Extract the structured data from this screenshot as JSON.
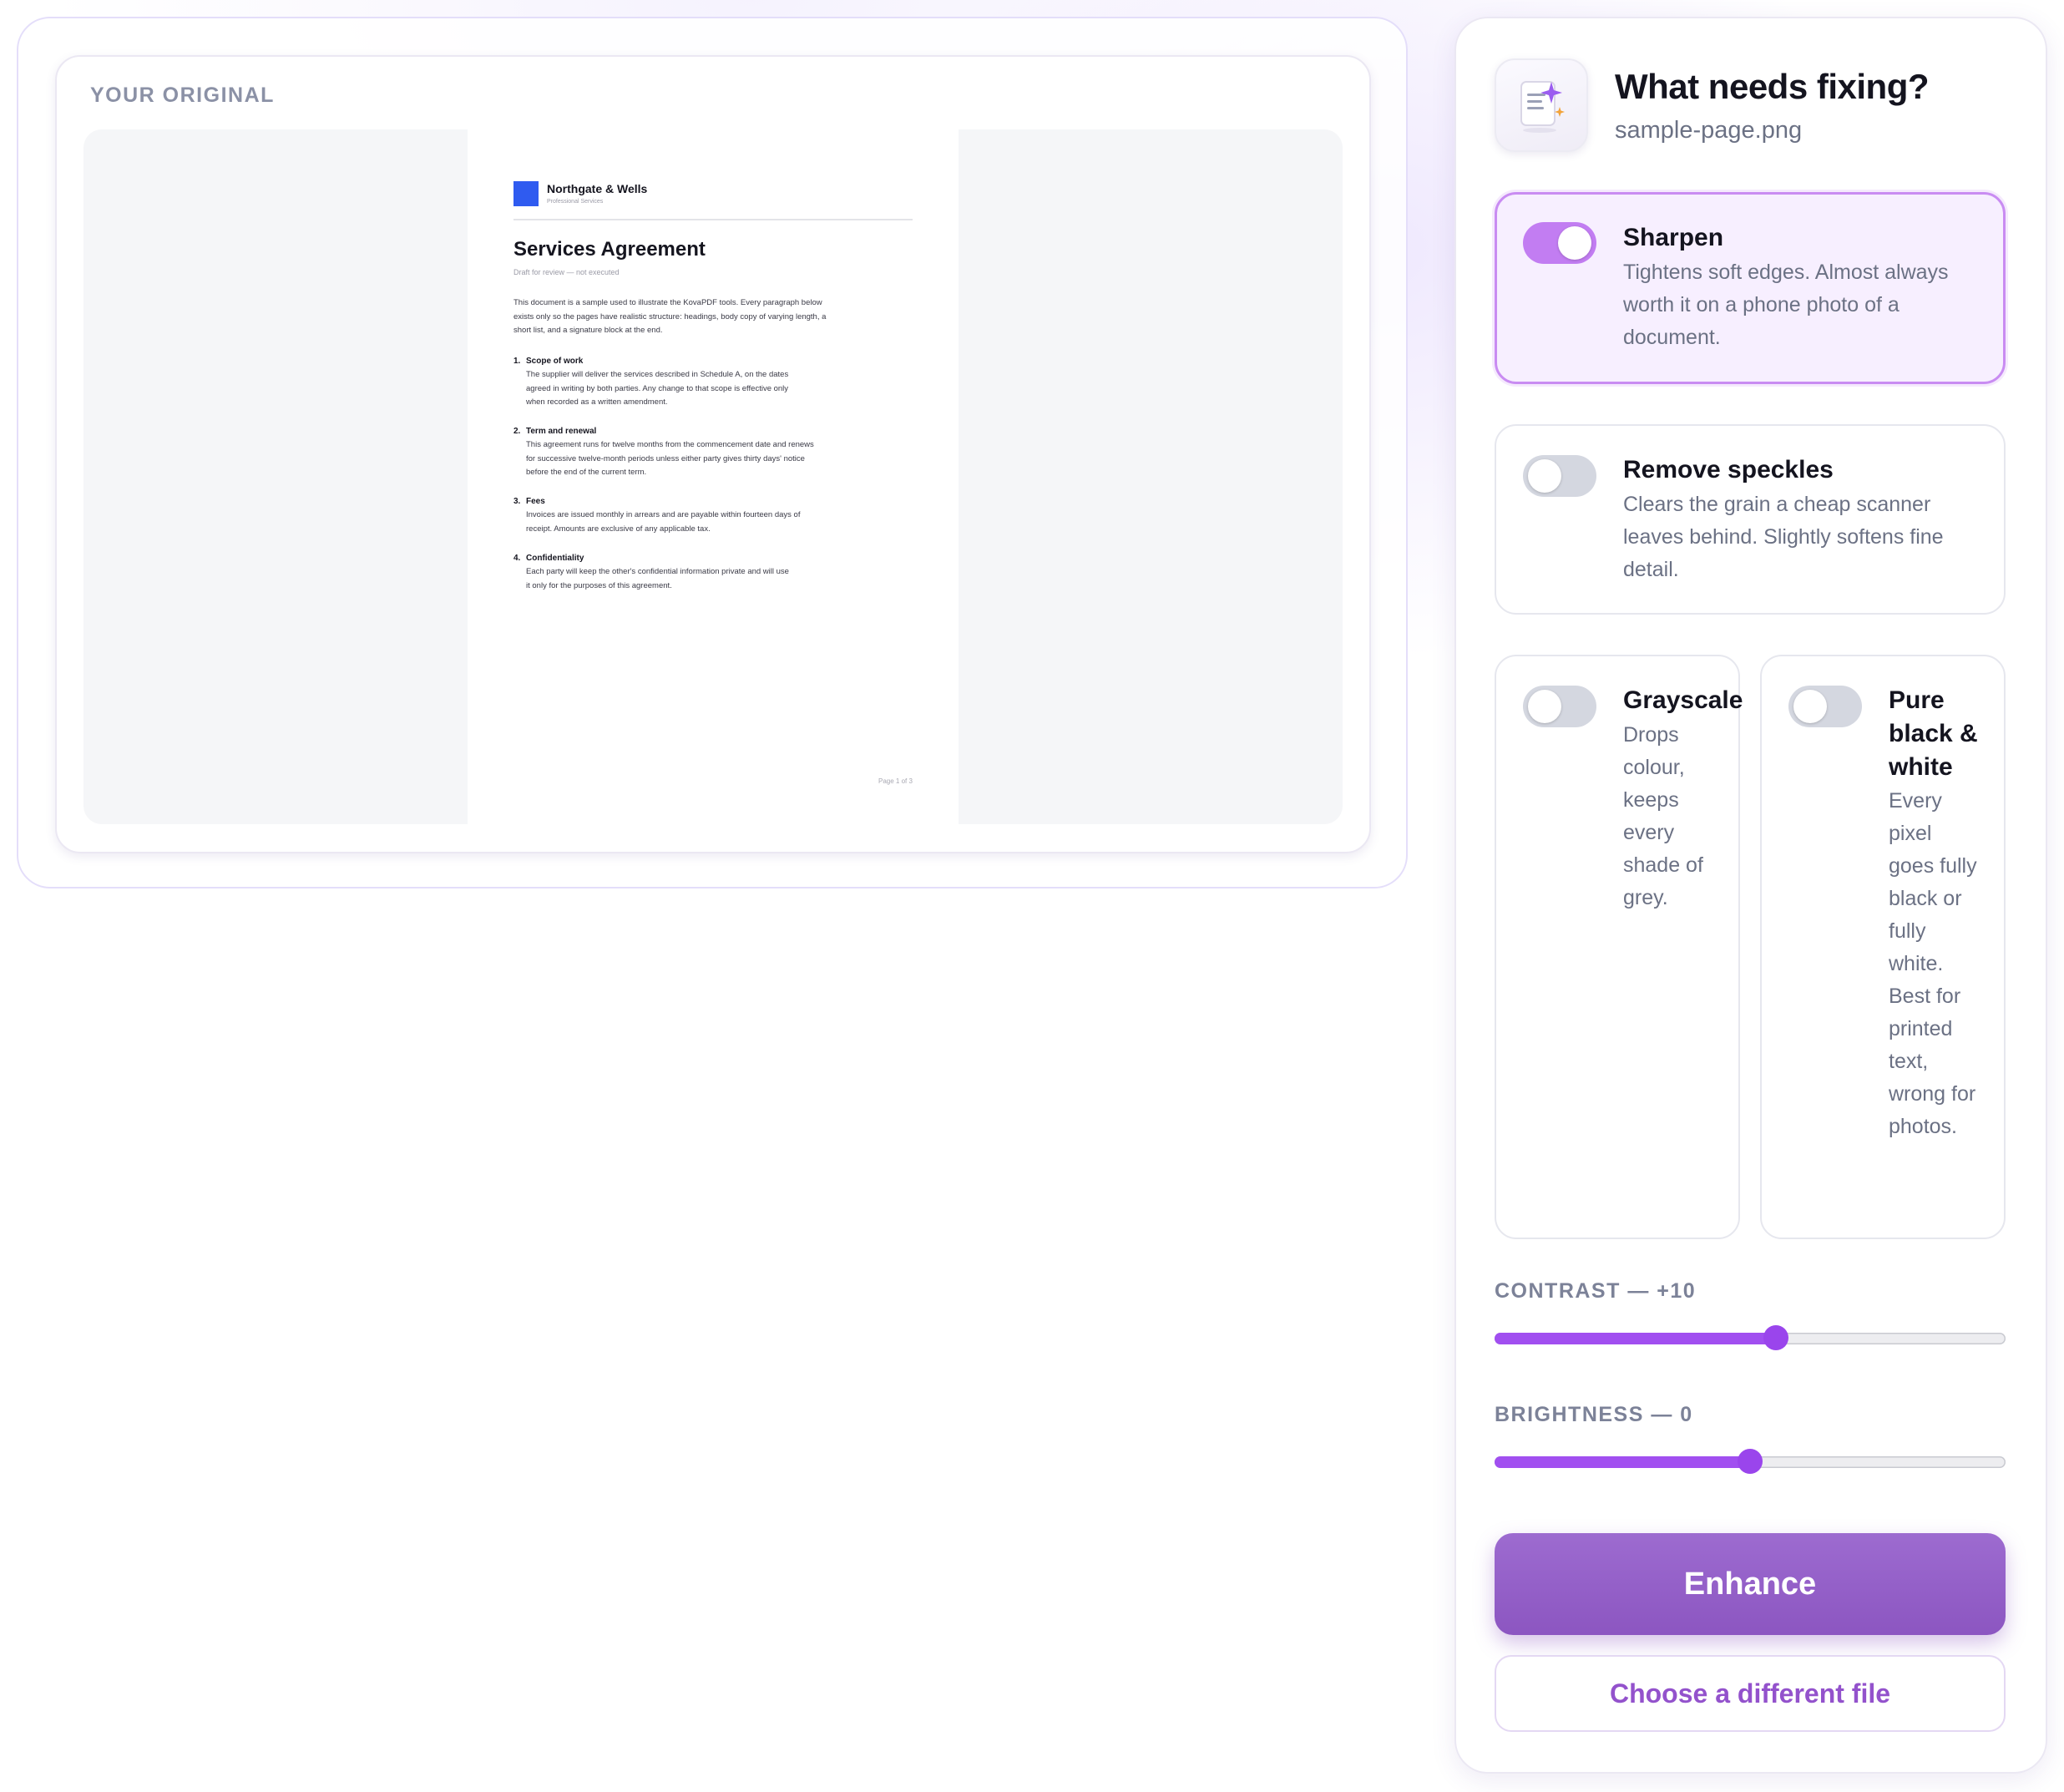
{
  "preview": {
    "label": "YOUR ORIGINAL",
    "document": {
      "company": "Northgate & Wells",
      "company_sub": "Professional Services",
      "title": "Services Agreement",
      "subtitle": "Draft for review — not executed",
      "intro": "This document is a sample used to illustrate the KovaPDF tools. Every paragraph below exists only so the pages have realistic structure: headings, body copy of varying length, a short list, and a signature block at the end.",
      "sections": [
        {
          "num": "1.",
          "heading": "Scope of work",
          "body": "The supplier will deliver the services described in Schedule A, on the dates agreed in writing by both parties. Any change to that scope is effective only when recorded as a written amendment."
        },
        {
          "num": "2.",
          "heading": "Term and renewal",
          "body": "This agreement runs for twelve months from the commencement date and renews for successive twelve-month periods unless either party gives thirty days' notice before the end of the current term."
        },
        {
          "num": "3.",
          "heading": "Fees",
          "body": "Invoices are issued monthly in arrears and are payable within fourteen days of receipt. Amounts are exclusive of any applicable tax."
        },
        {
          "num": "4.",
          "heading": "Confidentiality",
          "body": "Each party will keep the other's confidential information private and will use it only for the purposes of this agreement."
        }
      ],
      "footer": "Page 1 of 3"
    }
  },
  "panel": {
    "icon": "document-sparkle-icon",
    "title": "What needs fixing?",
    "filename": "sample-page.png",
    "options": {
      "sharpen": {
        "title": "Sharpen",
        "desc": "Tightens soft edges. Almost always worth it on a phone photo of a document.",
        "enabled": true
      },
      "speckles": {
        "title": "Remove speckles",
        "desc": "Clears the grain a cheap scanner leaves behind. Slightly softens fine detail.",
        "enabled": false
      },
      "grayscale": {
        "title": "Grayscale",
        "desc": "Drops colour, keeps every shade of grey.",
        "enabled": false
      },
      "bw": {
        "title": "Pure black & white",
        "desc": "Every pixel goes fully black or fully white. Best for printed text, wrong for photos.",
        "enabled": false
      }
    },
    "contrast": {
      "label": "CONTRAST — +10",
      "value": 10,
      "min": -100,
      "max": 100
    },
    "brightness": {
      "label": "BRIGHTNESS — 0",
      "value": 0,
      "min": -100,
      "max": 100
    },
    "enhance_label": "Enhance",
    "choose_label": "Choose a different file"
  },
  "colors": {
    "accent": "#a14ff0",
    "toggle_on": "#c27df2",
    "button": "#9166c8",
    "active_card_bg": "#f7efff"
  }
}
